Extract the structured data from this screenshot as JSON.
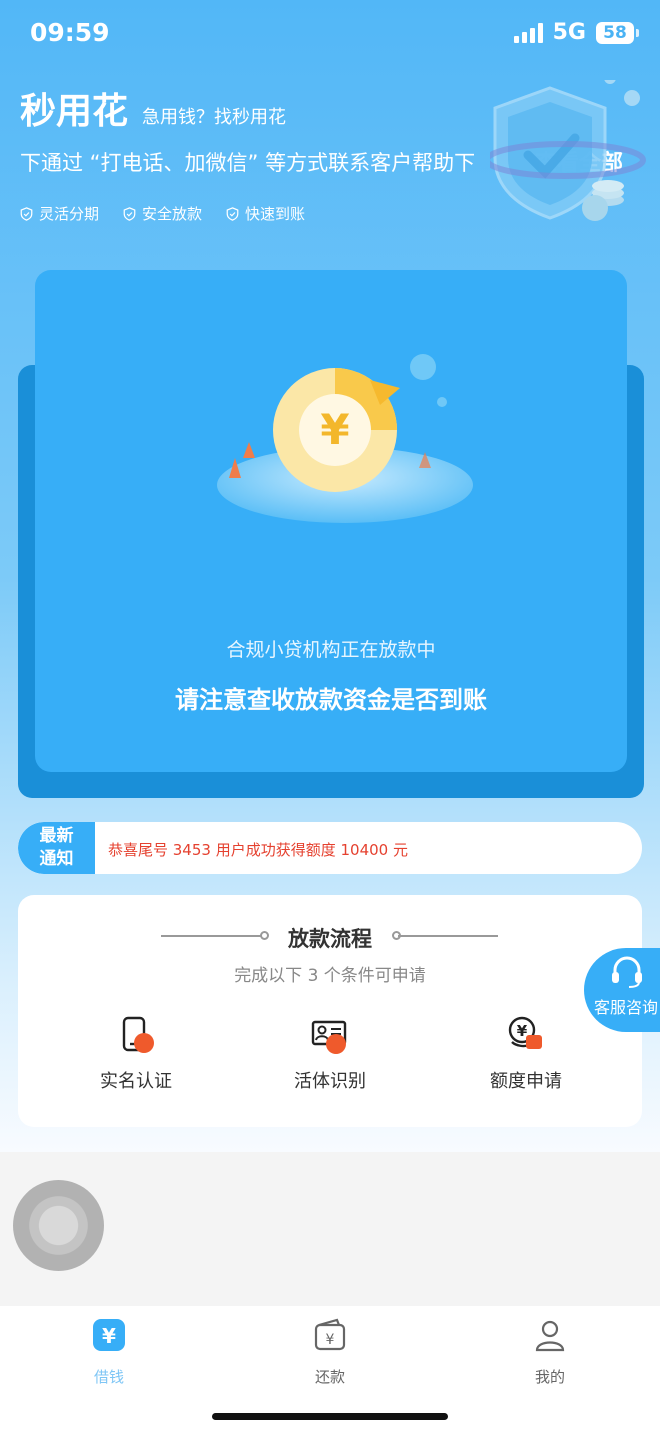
{
  "status_bar": {
    "time": "09:59",
    "network": "5G",
    "battery": "58"
  },
  "header": {
    "app_name": "秒用花",
    "slogan": "急用钱？找秒用花",
    "notice": "下通过 “打电话、加微信” 等方式联系客户帮助下",
    "view_all": "查看全部",
    "features": [
      "灵活分期",
      "安全放款",
      "快速到账"
    ]
  },
  "main_card": {
    "status_line": "合规小贷机构正在放款中",
    "highlight_line": "请注意查收放款资金是否到账"
  },
  "news": {
    "tag_line1": "最新",
    "tag_line2": "通知",
    "message": "恭喜尾号 3453 用户成功获得额度 10400 元"
  },
  "process": {
    "title": "放款流程",
    "subtitle": "完成以下 3 个条件可申请",
    "steps": [
      "实名认证",
      "活体识别",
      "额度申请"
    ]
  },
  "service_button": {
    "label": "客服咨询"
  },
  "tabbar": {
    "tabs": [
      "借钱",
      "还款",
      "我的"
    ],
    "active": "借钱"
  },
  "colors": {
    "accent": "#37aef7",
    "accent_dark": "#1a8fd8",
    "news_red": "#e5412f",
    "step_orange": "#ef5a2c"
  }
}
